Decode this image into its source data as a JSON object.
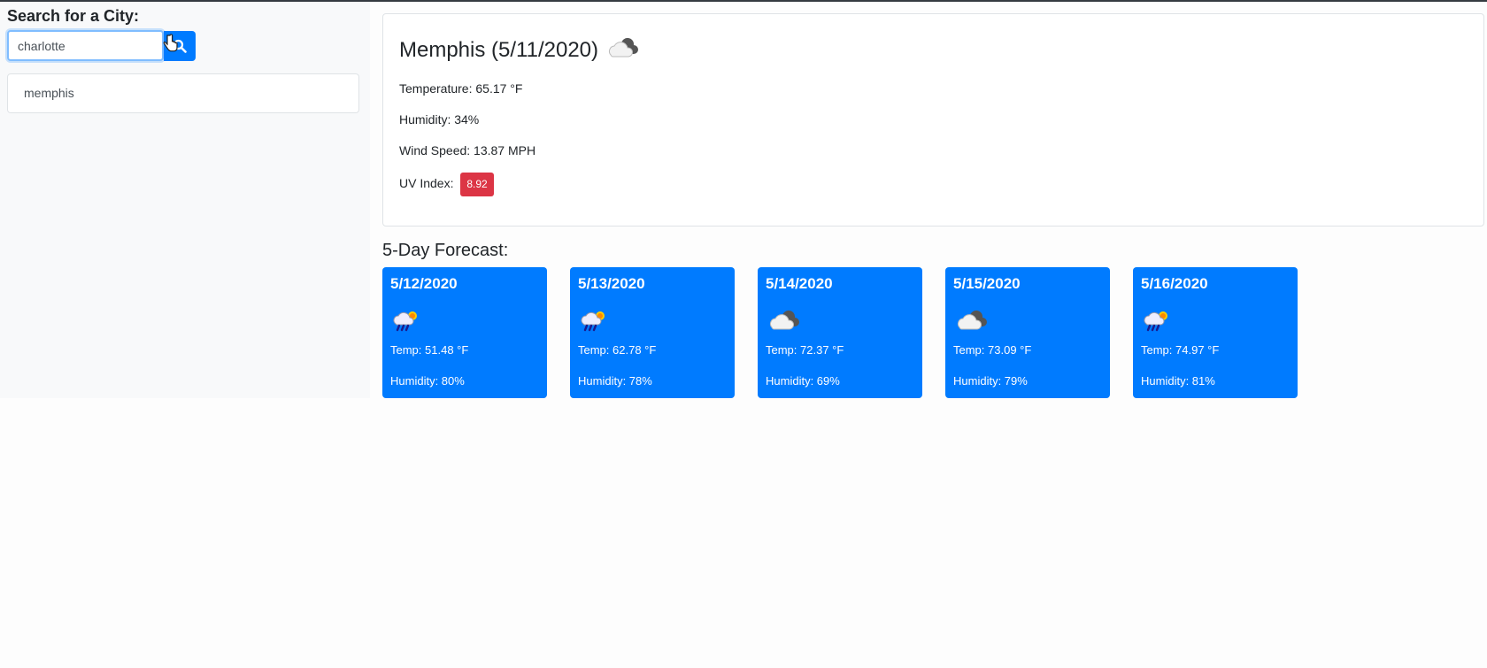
{
  "search": {
    "title": "Search for a City:",
    "input_value": "charlotte",
    "button_icon": "search-icon"
  },
  "history": [
    "memphis"
  ],
  "current": {
    "city_title": "Memphis (5/11/2020)",
    "icon": "cloudy-icon",
    "temperature": "Temperature: 65.17 °F",
    "humidity": "Humidity: 34%",
    "wind": "Wind Speed: 13.87 MPH",
    "uv_label": "UV Index:",
    "uv_value": "8.92",
    "uv_color": "#dc3545"
  },
  "forecast": {
    "title": "5-Day Forecast:",
    "card_color": "#007bff",
    "days": [
      {
        "date": "5/12/2020",
        "icon": "rain-sun-icon",
        "temp": "Temp: 51.48 °F",
        "humidity": "Humidity: 80%"
      },
      {
        "date": "5/13/2020",
        "icon": "rain-sun-icon",
        "temp": "Temp: 62.78 °F",
        "humidity": "Humidity: 78%"
      },
      {
        "date": "5/14/2020",
        "icon": "cloudy-icon",
        "temp": "Temp: 72.37 °F",
        "humidity": "Humidity: 69%"
      },
      {
        "date": "5/15/2020",
        "icon": "cloudy-icon",
        "temp": "Temp: 73.09 °F",
        "humidity": "Humidity: 79%"
      },
      {
        "date": "5/16/2020",
        "icon": "rain-sun-icon",
        "temp": "Temp: 74.97 °F",
        "humidity": "Humidity: 81%"
      }
    ]
  }
}
